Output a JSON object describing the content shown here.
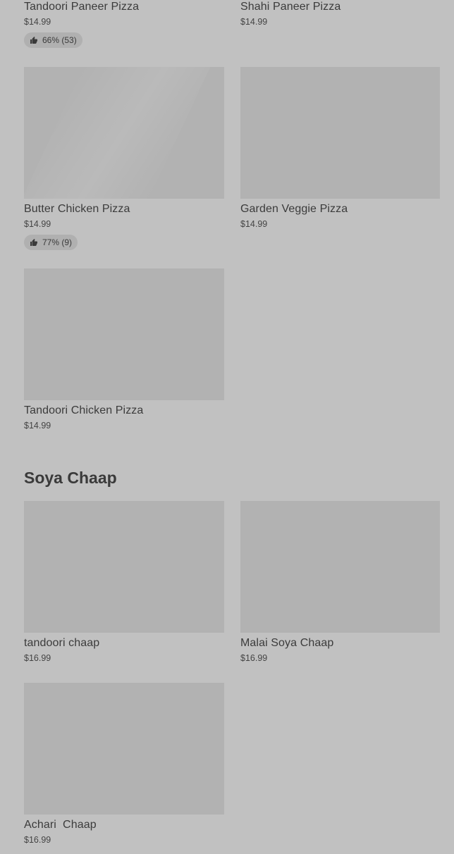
{
  "pizza_items": [
    {
      "name": "Tandoori Paneer Pizza",
      "price": "$14.99",
      "rating": "66% (53)"
    },
    {
      "name": "Shahi Paneer Pizza",
      "price": "$14.99"
    },
    {
      "name": "Butter Chicken Pizza",
      "price": "$14.99",
      "rating": "77% (9)"
    },
    {
      "name": "Garden Veggie Pizza",
      "price": "$14.99"
    },
    {
      "name": "Tandoori Chicken Pizza",
      "price": "$14.99"
    }
  ],
  "soya_section": {
    "title": "Soya Chaap",
    "items": [
      {
        "name": "tandoori chaap",
        "price": "$16.99"
      },
      {
        "name": "Malai Soya Chaap",
        "price": "$16.99"
      },
      {
        "name": "Achari  Chaap",
        "price": "$16.99"
      }
    ]
  },
  "icons": {
    "rating": "thumbs-up-icon"
  }
}
